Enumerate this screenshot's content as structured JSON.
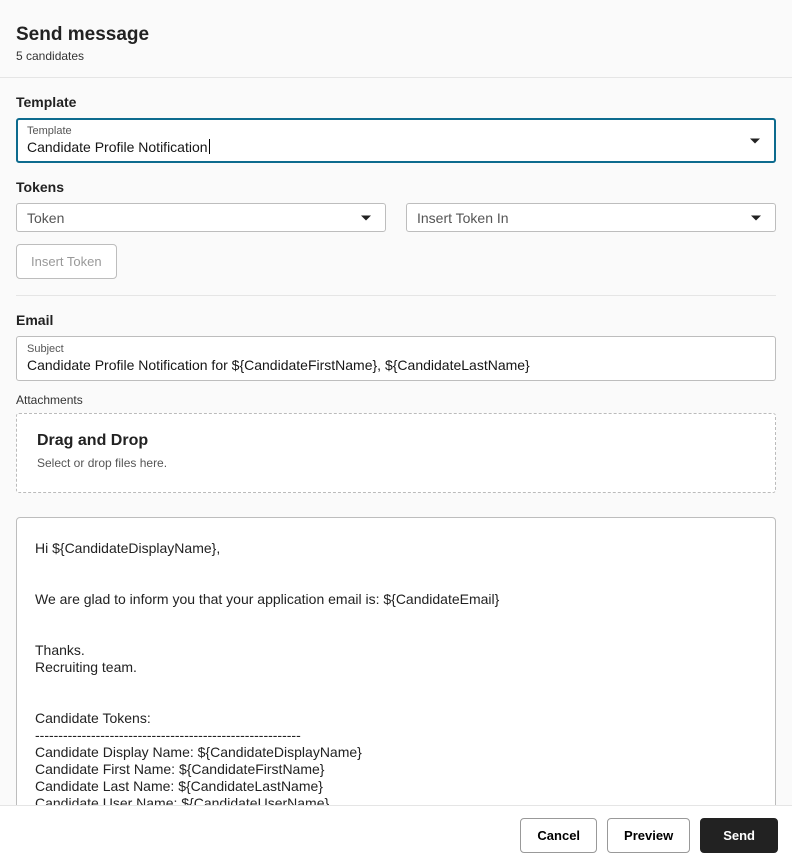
{
  "header": {
    "title": "Send message",
    "subtitle": "5 candidates"
  },
  "template": {
    "section_label": "Template",
    "field_label": "Template",
    "value": "Candidate Profile Notification"
  },
  "tokens": {
    "section_label": "Tokens",
    "token_field_label": "Token",
    "insert_field_label": "Insert Token In",
    "insert_button": "Insert Token"
  },
  "email": {
    "section_label": "Email",
    "subject_label": "Subject",
    "subject_value": "Candidate Profile Notification for ${CandidateFirstName}, ${CandidateLastName}"
  },
  "attachments": {
    "section_label": "Attachments",
    "drop_title": "Drag and Drop",
    "drop_hint": "Select or drop files here."
  },
  "body_text": "Hi ${CandidateDisplayName},\n\n\nWe are glad to inform you that your application email is: ${CandidateEmail}\n\n\nThanks.\nRecruiting team.\n\n\nCandidate Tokens:\n---------------------------------------------------------\nCandidate Display Name: ${CandidateDisplayName}\nCandidate First Name: ${CandidateFirstName}\nCandidate Last Name: ${CandidateLastName}\nCandidate User Name: ${CandidateUserName}",
  "footer": {
    "cancel": "Cancel",
    "preview": "Preview",
    "send": "Send"
  }
}
